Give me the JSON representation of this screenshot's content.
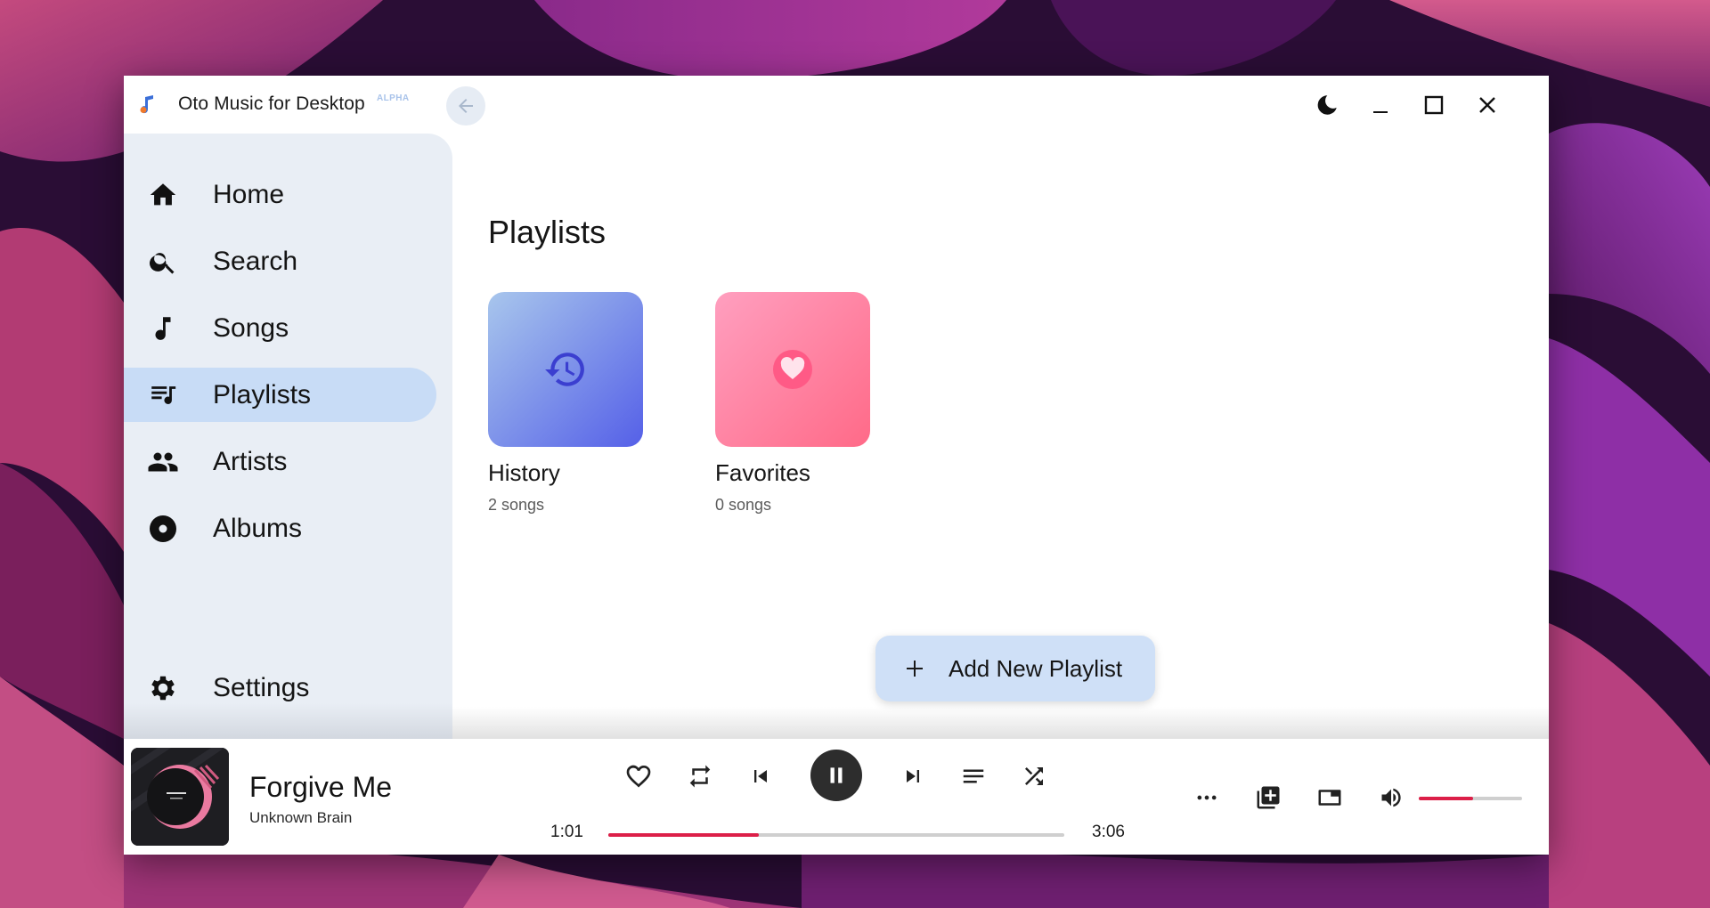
{
  "app": {
    "title": "Oto Music for Desktop",
    "badge": "ALPHA"
  },
  "sidebar": {
    "items": [
      {
        "label": "Home",
        "icon": "home-icon",
        "active": false
      },
      {
        "label": "Search",
        "icon": "search-icon",
        "active": false
      },
      {
        "label": "Songs",
        "icon": "music-note-icon",
        "active": false
      },
      {
        "label": "Playlists",
        "icon": "playlist-icon",
        "active": true
      },
      {
        "label": "Artists",
        "icon": "people-icon",
        "active": false
      },
      {
        "label": "Albums",
        "icon": "disc-icon",
        "active": false
      }
    ],
    "settings": {
      "label": "Settings",
      "icon": "gear-icon"
    }
  },
  "main": {
    "title": "Playlists",
    "playlists": [
      {
        "title": "History",
        "subtitle": "2 songs",
        "icon": "history-icon"
      },
      {
        "title": "Favorites",
        "subtitle": "0 songs",
        "icon": "heart-icon"
      }
    ],
    "add_button": "Add New Playlist"
  },
  "player": {
    "track_title": "Forgive Me",
    "artist": "Unknown Brain",
    "elapsed": "1:01",
    "duration": "3:06",
    "progress": 0.33,
    "volume": 0.53,
    "state": "playing"
  },
  "colors": {
    "accent": "#dc1f48",
    "sidebar_bg": "#e9eef5",
    "nav_active": "#c8dcf6",
    "add_button": "#cfe0f7"
  }
}
